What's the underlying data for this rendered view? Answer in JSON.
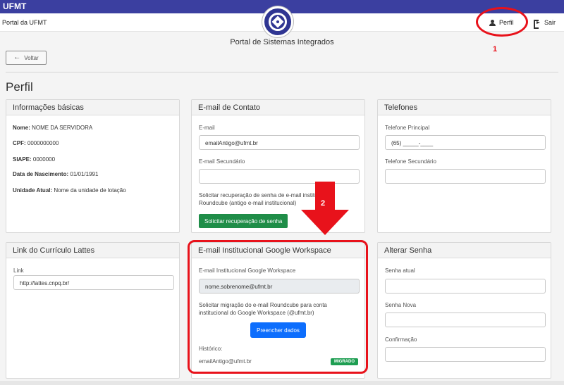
{
  "header": {
    "brand": "UFMT",
    "portal_link": "Portal da UFMT",
    "profile_label": "Perfil",
    "logout_label": "Sair",
    "subtitle": "Portal de Sistemas Integrados"
  },
  "annotations": {
    "one": "1",
    "two": "2"
  },
  "nav": {
    "back_label": "Voltar"
  },
  "page": {
    "title": "Perfil"
  },
  "basic_info": {
    "title": "Informações básicas",
    "name_label": "Nome:",
    "name_value": "NOME DA SERVIDORA",
    "cpf_label": "CPF:",
    "cpf_value": "0000000000",
    "siape_label": "SIAPE:",
    "siape_value": "0000000",
    "birth_label": "Data de Nascimento:",
    "birth_value": "01/01/1991",
    "unit_label": "Unidade Atual:",
    "unit_value": "Nome da unidade de lotação"
  },
  "contact_email": {
    "title": "E-mail de Contato",
    "email_label": "E-mail",
    "email_value": "emailAntigo@ufmt.br",
    "secondary_label": "E-mail Secundário",
    "secondary_value": "",
    "helper": "Solicitar recuperação de senha de e-mail institucional Roundcube (antigo e-mail institucional)",
    "button_label": "Solicitar recuperação de senha"
  },
  "phones": {
    "title": "Telefones",
    "main_label": "Telefone Principal",
    "main_value": "(65) _____-____",
    "secondary_label": "Telefone Secundário",
    "secondary_value": ""
  },
  "lattes": {
    "title": "Link do Currículo Lattes",
    "link_label": "Link",
    "link_value": "http://lattes.cnpq.br/"
  },
  "google_workspace": {
    "title": "E-mail Institucional Google Workspace",
    "email_label": "E-mail Institucional Google Workspace",
    "email_value": "nome.sobrenome@ufmt.br",
    "helper": "Solicitar migração do e-mail Roundcube para conta institucional do Google Workspace (@ufmt.br)",
    "button_label": "Preencher dados",
    "history_label": "Histórico:",
    "history_email": "emailAntigo@ufmt.br",
    "history_status": "MIGRADO"
  },
  "password": {
    "title": "Alterar Senha",
    "current_label": "Senha atual",
    "new_label": "Senha Nova",
    "confirm_label": "Confirmação"
  },
  "colors": {
    "topbar": "#3b3fa0",
    "annotation": "#e8121b",
    "button_green": "#1f8d48",
    "button_blue": "#0d6efd",
    "badge": "#1e9e52"
  }
}
